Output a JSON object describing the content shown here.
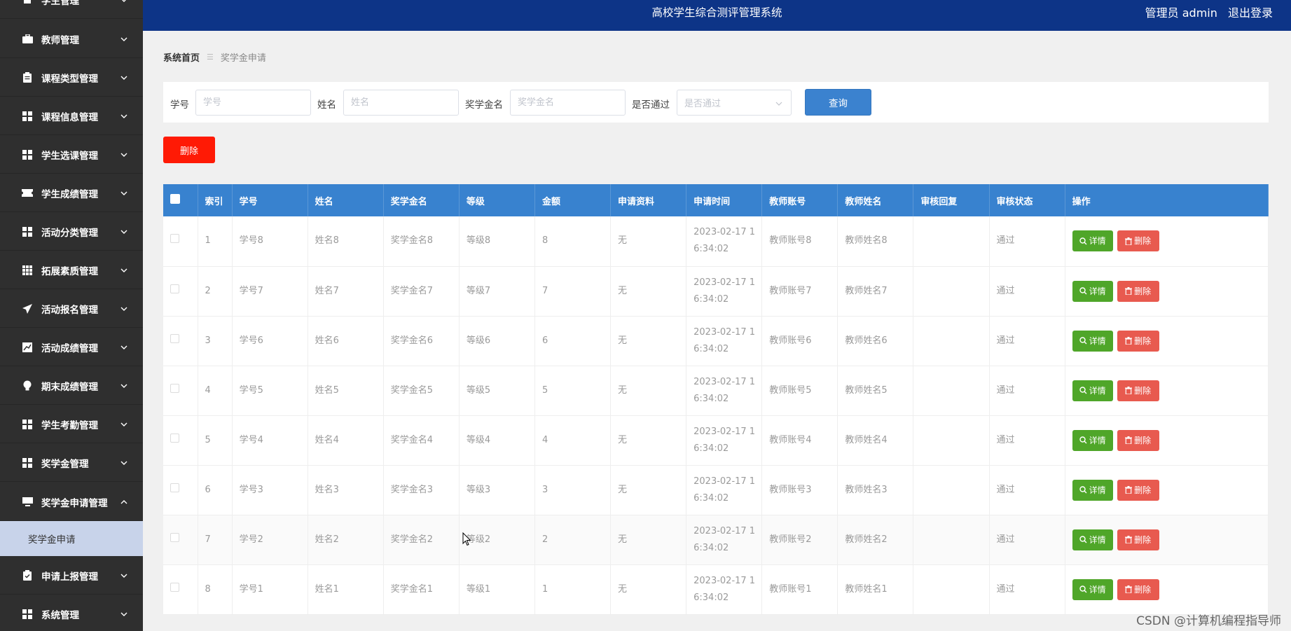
{
  "sidebar": {
    "items": [
      {
        "label": "学生管理",
        "icon": "user-icon"
      },
      {
        "label": "教师管理",
        "icon": "briefcase-icon"
      },
      {
        "label": "课程类型管理",
        "icon": "clipboard-icon"
      },
      {
        "label": "课程信息管理",
        "icon": "grid-icon"
      },
      {
        "label": "学生选课管理",
        "icon": "grid-icon"
      },
      {
        "label": "学生成绩管理",
        "icon": "ticket-icon"
      },
      {
        "label": "活动分类管理",
        "icon": "grid-icon"
      },
      {
        "label": "拓展素质管理",
        "icon": "apps-icon"
      },
      {
        "label": "活动报名管理",
        "icon": "send-icon"
      },
      {
        "label": "活动成绩管理",
        "icon": "chart-icon"
      },
      {
        "label": "期末成绩管理",
        "icon": "bulb-icon"
      },
      {
        "label": "学生考勤管理",
        "icon": "grid-icon"
      },
      {
        "label": "奖学金管理",
        "icon": "grid-icon"
      },
      {
        "label": "奖学金申请管理",
        "icon": "monitor-icon"
      },
      {
        "label": "申请上报管理",
        "icon": "clipboard-check-icon"
      },
      {
        "label": "系统管理",
        "icon": "grid-icon"
      }
    ],
    "submenu_active": "奖学金申请"
  },
  "header": {
    "title": "高校学生综合测评管理系统",
    "user": "管理员 admin",
    "logout": "退出登录"
  },
  "breadcrumb": {
    "home": "系统首页",
    "current": "奖学金申请"
  },
  "search": {
    "student_no_label": "学号",
    "student_no_placeholder": "学号",
    "name_label": "姓名",
    "name_placeholder": "姓名",
    "scholarship_label": "奖学金名",
    "scholarship_placeholder": "奖学金名",
    "passed_label": "是否通过",
    "passed_placeholder": "是否通过",
    "query_button": "查询"
  },
  "toolbar": {
    "delete_button": "删除"
  },
  "table": {
    "columns": [
      "索引",
      "学号",
      "姓名",
      "奖学金名",
      "等级",
      "金额",
      "申请资料",
      "申请时间",
      "教师账号",
      "教师姓名",
      "审核回复",
      "审核状态",
      "操作"
    ],
    "detail_label": "详情",
    "delete_label": "删除",
    "rows": [
      {
        "index": "1",
        "student_no": "学号8",
        "name": "姓名8",
        "scholarship": "奖学金名8",
        "level": "等级8",
        "amount": "8",
        "material": "无",
        "time_1": "2023-02-17 1",
        "time_2": "6:34:02",
        "teacher_account": "教师账号8",
        "teacher_name": "教师姓名8",
        "reply": "",
        "status": "通过"
      },
      {
        "index": "2",
        "student_no": "学号7",
        "name": "姓名7",
        "scholarship": "奖学金名7",
        "level": "等级7",
        "amount": "7",
        "material": "无",
        "time_1": "2023-02-17 1",
        "time_2": "6:34:02",
        "teacher_account": "教师账号7",
        "teacher_name": "教师姓名7",
        "reply": "",
        "status": "通过"
      },
      {
        "index": "3",
        "student_no": "学号6",
        "name": "姓名6",
        "scholarship": "奖学金名6",
        "level": "等级6",
        "amount": "6",
        "material": "无",
        "time_1": "2023-02-17 1",
        "time_2": "6:34:02",
        "teacher_account": "教师账号6",
        "teacher_name": "教师姓名6",
        "reply": "",
        "status": "通过"
      },
      {
        "index": "4",
        "student_no": "学号5",
        "name": "姓名5",
        "scholarship": "奖学金名5",
        "level": "等级5",
        "amount": "5",
        "material": "无",
        "time_1": "2023-02-17 1",
        "time_2": "6:34:02",
        "teacher_account": "教师账号5",
        "teacher_name": "教师姓名5",
        "reply": "",
        "status": "通过"
      },
      {
        "index": "5",
        "student_no": "学号4",
        "name": "姓名4",
        "scholarship": "奖学金名4",
        "level": "等级4",
        "amount": "4",
        "material": "无",
        "time_1": "2023-02-17 1",
        "time_2": "6:34:02",
        "teacher_account": "教师账号4",
        "teacher_name": "教师姓名4",
        "reply": "",
        "status": "通过"
      },
      {
        "index": "6",
        "student_no": "学号3",
        "name": "姓名3",
        "scholarship": "奖学金名3",
        "level": "等级3",
        "amount": "3",
        "material": "无",
        "time_1": "2023-02-17 1",
        "time_2": "6:34:02",
        "teacher_account": "教师账号3",
        "teacher_name": "教师姓名3",
        "reply": "",
        "status": "通过"
      },
      {
        "index": "7",
        "student_no": "学号2",
        "name": "姓名2",
        "scholarship": "奖学金名2",
        "level": "等级2",
        "amount": "2",
        "material": "无",
        "time_1": "2023-02-17 1",
        "time_2": "6:34:02",
        "teacher_account": "教师账号2",
        "teacher_name": "教师姓名2",
        "reply": "",
        "status": "通过"
      },
      {
        "index": "8",
        "student_no": "学号1",
        "name": "姓名1",
        "scholarship": "奖学金名1",
        "level": "等级1",
        "amount": "1",
        "material": "无",
        "time_1": "2023-02-17 1",
        "time_2": "6:34:02",
        "teacher_account": "教师账号1",
        "teacher_name": "教师姓名1",
        "reply": "",
        "status": "通过"
      }
    ]
  },
  "watermark": "CSDN @计算机编程指导师",
  "colors": {
    "header_bg": "#0d3487",
    "sidebar_bg": "#2f2f2f",
    "table_header_bg": "#3882cf",
    "detail_button": "#4fa629",
    "delete_button": "#e85a4f",
    "top_delete_button": "#ff1a05",
    "query_button": "#3b82cf"
  }
}
